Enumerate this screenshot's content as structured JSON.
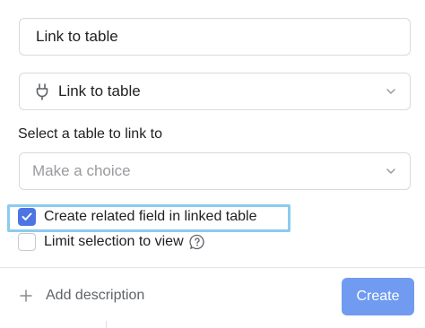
{
  "form": {
    "field_name_value": "Link to table",
    "field_type": {
      "label": "Link to table",
      "icon": "plug-icon"
    },
    "table_section_label": "Select a table to link to",
    "table_select": {
      "placeholder": "Make a choice"
    },
    "options": {
      "create_related_label": "Create related field in linked table",
      "create_related_checked": true,
      "limit_selection_label": "Limit selection to view",
      "limit_selection_checked": false
    }
  },
  "footer": {
    "add_description_label": "Add description",
    "create_label": "Create"
  },
  "colors": {
    "accent": "#4c74e2",
    "create_button": "#709bf0",
    "highlight": "#8bcbf0"
  }
}
